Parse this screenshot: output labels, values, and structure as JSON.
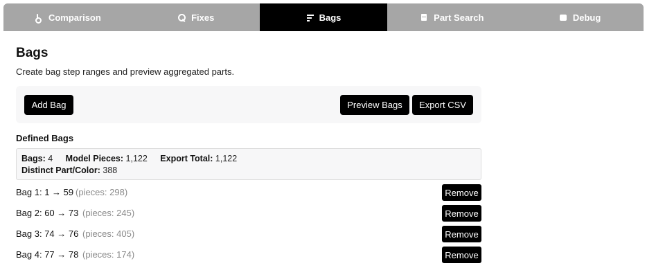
{
  "tabs": [
    {
      "label": "Comparison",
      "icon": "note-icon",
      "active": false
    },
    {
      "label": "Fixes",
      "icon": "search-icon",
      "active": false
    },
    {
      "label": "Bags",
      "icon": "bars-icon",
      "active": true
    },
    {
      "label": "Part Search",
      "icon": "document-icon",
      "active": false
    },
    {
      "label": "Debug",
      "icon": "square-icon",
      "active": false
    }
  ],
  "page": {
    "title": "Bags",
    "subtitle": "Create bag step ranges and preview aggregated parts."
  },
  "toolbar": {
    "add_label": "Add Bag",
    "preview_label": "Preview Bags",
    "export_label": "Export CSV"
  },
  "section_title": "Defined Bags",
  "summary": {
    "bags_label": "Bags:",
    "bags_value": "4",
    "model_pieces_label": "Model Pieces:",
    "model_pieces_value": "1,122",
    "export_total_label": "Export Total:",
    "export_total_value": "1,122",
    "distinct_label": "Distinct Part/Color:",
    "distinct_value": "388"
  },
  "bags": [
    {
      "label": "Bag 1: 1 → 59",
      "pieces": "(pieces: 298)",
      "remove_label": "Remove"
    },
    {
      "label": "Bag 2: 60 → 73",
      "pieces": "(pieces: 245)",
      "remove_label": "Remove"
    },
    {
      "label": "Bag 3: 74 → 76",
      "pieces": "(pieces: 405)",
      "remove_label": "Remove"
    },
    {
      "label": "Bag 4: 77 → 78",
      "pieces": "(pieces: 174)",
      "remove_label": "Remove"
    }
  ],
  "colors": {
    "tab_bar": "#a6a6a6",
    "tab_active": "#000000",
    "button": "#000000",
    "panel": "#f7f7f8",
    "muted_text": "#8a8a8a"
  }
}
